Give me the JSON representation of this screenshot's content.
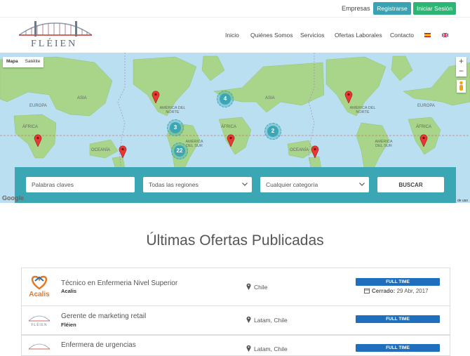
{
  "header": {
    "empresas": "Empresas",
    "register": "Registrarse",
    "login": "Iniciar Sesión",
    "logo_text": "FLÉIEN",
    "nav": [
      "Inicio",
      "Quiénes Somos",
      "Servicios",
      "Ofertas Laborales",
      "Contacto"
    ]
  },
  "map": {
    "type_map": "Mapa",
    "type_sat": "Satélite",
    "zoom_in": "+",
    "zoom_out": "−",
    "clusters": [
      "4",
      "3",
      "22",
      "2"
    ],
    "labels": {
      "asia": "ASIA",
      "europa": "EUROPA",
      "africa": "ÁFRICA",
      "oceania": "OCEANÍA",
      "na": "AMÉRICA DEL NORTE",
      "sa": "AMÉRICA DEL SUR"
    },
    "google": "Google",
    "terms": "de uso"
  },
  "search": {
    "keywords_placeholder": "Palabras claves",
    "region": "Todas las regiones",
    "category": "Cualquier categoría",
    "button": "BUSCAR"
  },
  "section_title": "Últimas Ofertas Publicadas",
  "jobs": [
    {
      "title": "Técnico en Enfermeria Nivel Superior",
      "company": "Acalis",
      "location": "Chile",
      "type": "FULL TIME",
      "closed_label": "Cerrado:",
      "closed_date": "29 Abr, 2017"
    },
    {
      "title": "Gerente de marketing retail",
      "company": "Fléien",
      "location": "Latam, Chile",
      "type": "FULL TIME"
    },
    {
      "title": "Enfermera de urgencias",
      "company": "",
      "location": "Latam, Chile",
      "type": "FULL TIME"
    }
  ],
  "colors": {
    "teal": "#3aa3b3",
    "green": "#2bb673",
    "badge": "#1f6fbd",
    "band": "#3ba7b5"
  }
}
